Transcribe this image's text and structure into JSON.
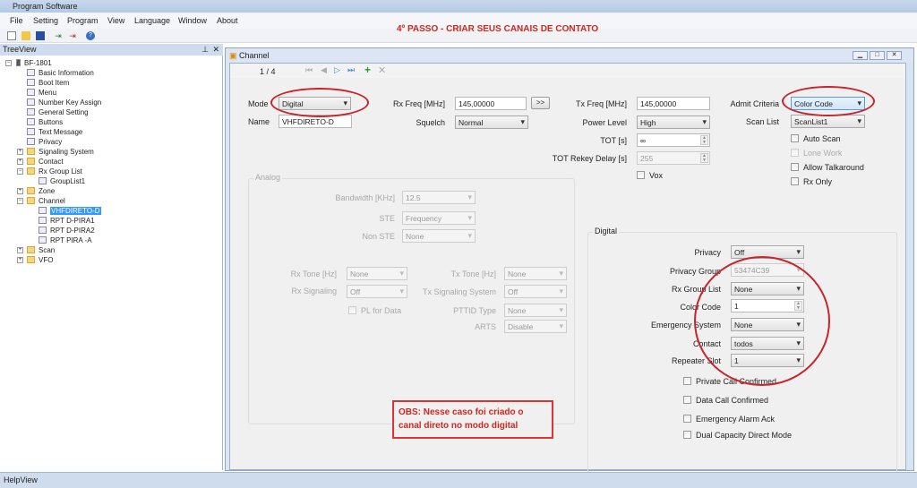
{
  "app": {
    "title": "Program Software"
  },
  "menu": [
    "File",
    "Setting",
    "Program",
    "View",
    "Language",
    "Window",
    "About"
  ],
  "toolbar_icons": [
    "new-file-icon",
    "open-folder-icon",
    "save-icon",
    "read-radio-icon",
    "write-radio-icon",
    "help-icon"
  ],
  "annotation": {
    "step": "4º PASSO - CRIAR SEUS CANAIS DE CONTATO",
    "obs": "OBS: Nesse caso foi criado o canal direto no modo digital",
    "color": "#d0271e"
  },
  "tree": {
    "title": "TreeView",
    "root": "BF-1801",
    "items": [
      "Basic Information",
      "Boot Item",
      "Menu",
      "Number Key Assign",
      "General Setting",
      "Buttons",
      "Text Message",
      "Privacy",
      "Signaling System",
      "Contact",
      "Rx Group List",
      "GroupList1",
      "Zone",
      "Channel",
      "VHFDIRETO-D",
      "RPT D-PIRA1",
      "RPT D-PIRA2",
      "RPT PIRA -A",
      "Scan",
      "VFO"
    ]
  },
  "window": {
    "title": "Channel",
    "page": "1 / 4"
  },
  "form": {
    "mode": {
      "label": "Mode",
      "value": "Digital"
    },
    "name": {
      "label": "Name",
      "value": "VHFDIRETO-D"
    },
    "rx_freq": {
      "label": "Rx Freq [MHz]",
      "value": "145,00000",
      "copy": ">>"
    },
    "squelch": {
      "label": "Squelch",
      "value": "Normal"
    },
    "tx_freq": {
      "label": "Tx Freq [MHz]",
      "value": "145,00000"
    },
    "power": {
      "label": "Power Level",
      "value": "High"
    },
    "tot": {
      "label": "TOT [s]",
      "value": "∞"
    },
    "tot_rekey": {
      "label": "TOT Rekey Delay [s]",
      "value": "255"
    },
    "vox": "Vox",
    "admit": {
      "label": "Admit Criteria",
      "value": "Color Code"
    },
    "scan_list": {
      "label": "Scan List",
      "value": "ScanList1"
    },
    "auto_scan": "Auto Scan",
    "lone_work": "Lone Work",
    "talkaround": "Allow Talkaround",
    "rx_only": "Rx Only"
  },
  "analog": {
    "title": "Analog",
    "bandwidth": {
      "label": "Bandwidth [KHz]",
      "value": "12.5"
    },
    "ste": {
      "label": "STE",
      "value": "Frequency"
    },
    "non_ste": {
      "label": "Non STE",
      "value": "None"
    },
    "rx_tone": {
      "label": "Rx Tone [Hz]",
      "value": "None"
    },
    "tx_tone": {
      "label": "Tx Tone [Hz]",
      "value": "None"
    },
    "rx_sig": {
      "label": "Rx Signaling",
      "value": "Off"
    },
    "tx_sig": {
      "label": "Tx Signaling System",
      "value": "Off"
    },
    "pl_data": "PL for Data",
    "pttid": {
      "label": "PTTID Type",
      "value": "None"
    },
    "arts": {
      "label": "ARTS",
      "value": "Disable"
    }
  },
  "digital": {
    "title": "Digital",
    "privacy": {
      "label": "Privacy",
      "value": "Off"
    },
    "privacy_group": {
      "label": "Privacy Group",
      "value": "53474C39"
    },
    "rx_group": {
      "label": "Rx Group List",
      "value": "None"
    },
    "color_code": {
      "label": "Color Code",
      "value": "1"
    },
    "emergency": {
      "label": "Emergency System",
      "value": "None"
    },
    "contact": {
      "label": "Contact",
      "value": "todos"
    },
    "slot": {
      "label": "Repeater Slot",
      "value": "1"
    },
    "checks": [
      "Private Call Confirmed",
      "Data Call Confirmed",
      "Emergency Alarm Ack",
      "Dual Capacity Direct Mode"
    ]
  },
  "helpview": "HelpView"
}
